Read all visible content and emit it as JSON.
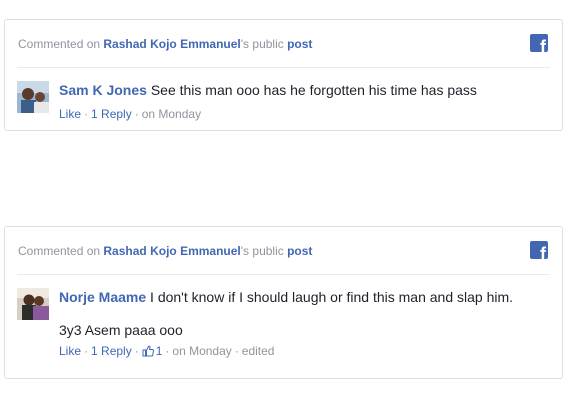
{
  "posts": [
    {
      "header": {
        "prefix": "Commented on",
        "owner": "Rashad Kojo Emmanuel",
        "possessive": "'s public",
        "post_link": "post",
        "fb_letter": "f"
      },
      "comment": {
        "author": "Sam K Jones",
        "text": "See this man ooo has he forgotten his time has pass",
        "like": "Like",
        "reply": "1 Reply",
        "timestamp": "on Monday"
      }
    },
    {
      "header": {
        "prefix": "Commented on",
        "owner": "Rashad Kojo Emmanuel",
        "possessive": "'s public",
        "post_link": "post",
        "fb_letter": "f"
      },
      "comment": {
        "author": "Norje Maame",
        "text": "I don't know if I should laugh or find this man and slap him.",
        "text2": "3y3 Asem paaa ooo",
        "like": "Like",
        "reply": "1 Reply",
        "like_count": "1",
        "timestamp": "on Monday",
        "edited": "edited"
      }
    }
  ],
  "colors": {
    "link": "#4267b2",
    "muted": "#90949c",
    "border": "#dddfe2"
  },
  "icons": {
    "facebook": "facebook-icon",
    "like": "thumbs-up-icon"
  }
}
